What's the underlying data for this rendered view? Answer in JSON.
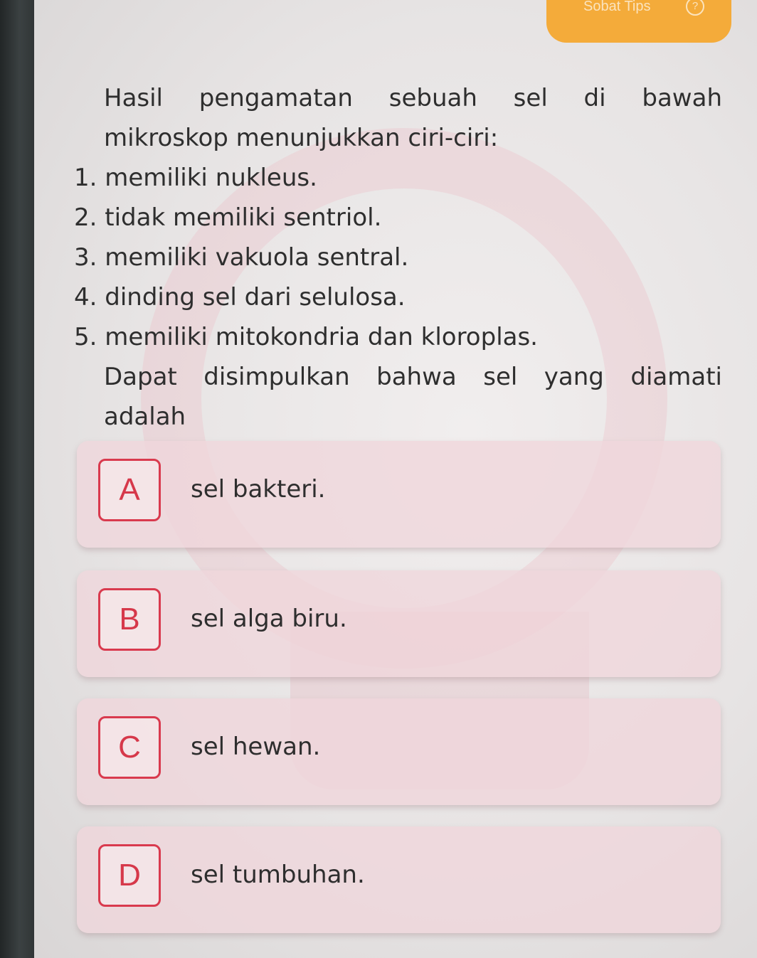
{
  "header": {
    "tips_label": "Sobat Tips",
    "help_icon": "?"
  },
  "question": {
    "intro_line1": "Hasil pengamatan sebuah sel di bawah",
    "intro_line2": "mikroskop menunjukkan ciri-ciri:",
    "criteria": [
      "1. memiliki nukleus.",
      "2. tidak memiliki sentriol.",
      "3. memiliki vakuola sentral.",
      "4. dinding sel dari selulosa.",
      "5. memiliki mitokondria dan kloroplas."
    ],
    "conclusion_line1": "Dapat disimpulkan bahwa sel yang diamati",
    "conclusion_line2": "adalah"
  },
  "options": [
    {
      "letter": "A",
      "text": "sel bakteri."
    },
    {
      "letter": "B",
      "text": "sel alga biru."
    },
    {
      "letter": "C",
      "text": "sel hewan."
    },
    {
      "letter": "D",
      "text": "sel tumbuhan."
    }
  ],
  "colors": {
    "accent": "#d93a4e",
    "badge": "#f4ab3a",
    "option_bg": "#efd6db",
    "text": "#2e2e2e"
  }
}
